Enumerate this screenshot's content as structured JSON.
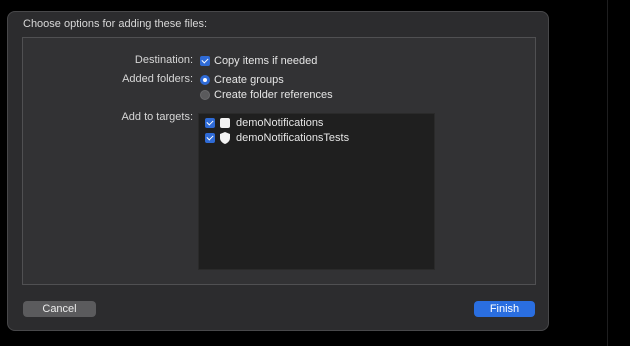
{
  "dialog": {
    "title": "Choose options for adding these files:",
    "destination": {
      "label": "Destination:",
      "option": "Copy items if needed",
      "checked": true
    },
    "added_folders": {
      "label": "Added folders:",
      "options": [
        {
          "label": "Create groups",
          "selected": true
        },
        {
          "label": "Create folder references",
          "selected": false
        }
      ]
    },
    "targets": {
      "label": "Add to targets:",
      "items": [
        {
          "name": "demoNotifications",
          "checked": true,
          "icon": "app-icon"
        },
        {
          "name": "demoNotificationsTests",
          "checked": true,
          "icon": "shield-icon"
        }
      ]
    },
    "buttons": {
      "cancel": "Cancel",
      "finish": "Finish"
    }
  },
  "colors": {
    "accent": "#2f6bd6",
    "sheet_bg": "#2c2c2e",
    "panel_bg": "#323234",
    "list_bg": "#1f1f1f"
  }
}
